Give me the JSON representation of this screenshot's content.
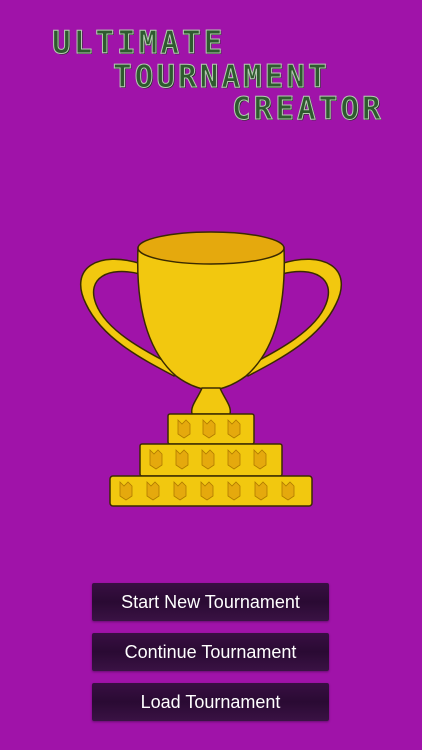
{
  "app": {
    "title_lines": [
      "ULTIMATE",
      "TOURNAMENT",
      "CREATOR"
    ],
    "background_color": "#a013a9",
    "trophy_icon": "trophy-icon"
  },
  "menu": {
    "start_label": "Start New Tournament",
    "continue_label": "Continue Tournament",
    "load_label": "Load Tournament"
  },
  "colors": {
    "title_fill": "#2e5a2e",
    "title_outline": "#b7c9b4",
    "trophy_gold": "#f2c80f",
    "button_bg": "#2a0a33",
    "button_text": "#ffffff"
  }
}
